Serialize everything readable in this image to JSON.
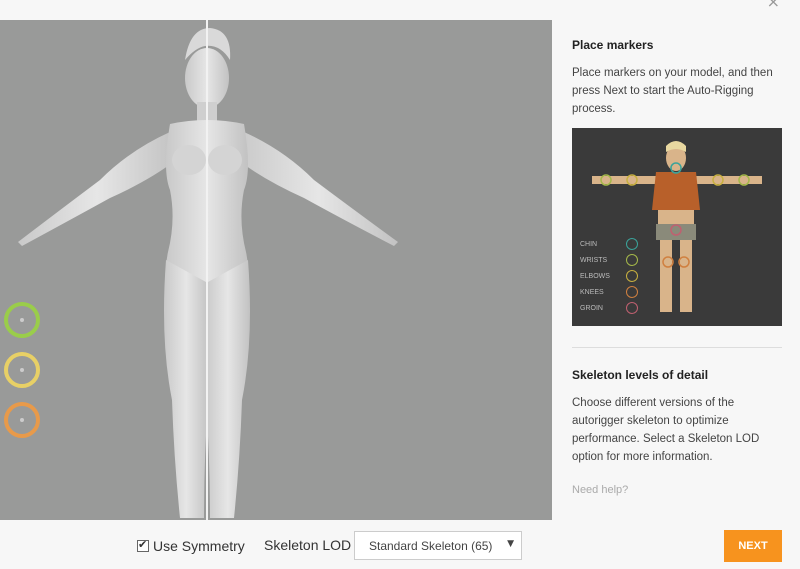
{
  "window": {
    "close_glyph": "×"
  },
  "viewport": {
    "markers": [
      {
        "name": "wrists",
        "color": "#9acd4a"
      },
      {
        "name": "elbows",
        "color": "#e8d066"
      },
      {
        "name": "knees",
        "color": "#e89a4a"
      }
    ]
  },
  "controls": {
    "use_symmetry_label": "Use Symmetry",
    "use_symmetry_checked": true,
    "skeleton_lod_label": "Skeleton LOD",
    "skeleton_lod_value": "Standard Skeleton (65)",
    "dropdown_arrow": "▼",
    "next_label": "NEXT"
  },
  "sidebar": {
    "place_markers_title": "Place markers",
    "place_markers_text": "Place markers on your model, and then press Next to start the Auto-Rigging process.",
    "legend": [
      {
        "label": "CHIN",
        "color": "#3aa39a"
      },
      {
        "label": "WRISTS",
        "color": "#a5b84a"
      },
      {
        "label": "ELBOWS",
        "color": "#c8b040"
      },
      {
        "label": "KNEES",
        "color": "#d08040"
      },
      {
        "label": "GROIN",
        "color": "#c06070"
      }
    ],
    "lod_title": "Skeleton levels of detail",
    "lod_text": "Choose different versions of the autorigger skeleton to optimize performance. Select a Skeleton LOD option for more information.",
    "help_link": "Need help?"
  },
  "colors": {
    "accent": "#f7931e",
    "viewport_bg": "#999a99"
  }
}
